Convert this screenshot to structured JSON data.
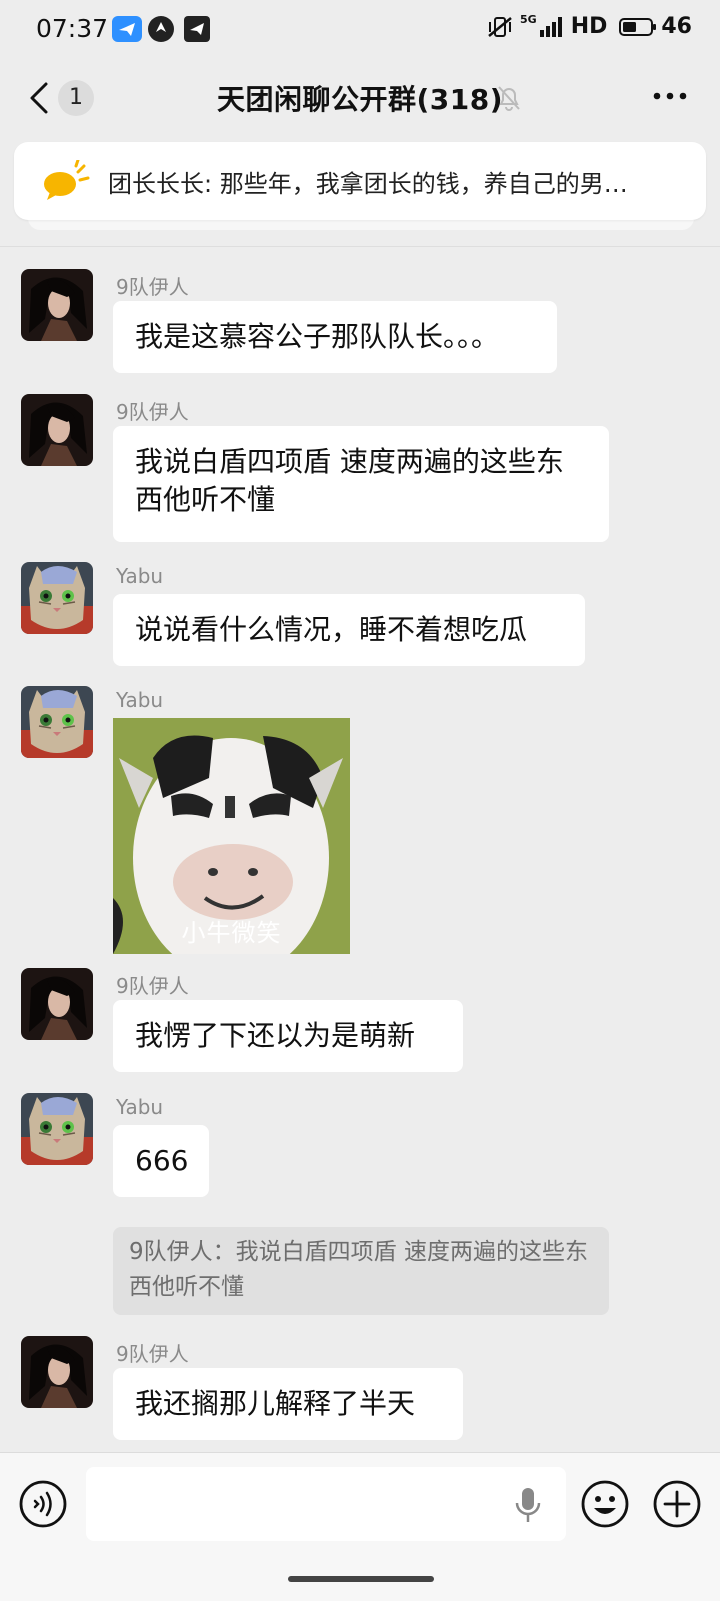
{
  "status_bar": {
    "time": "07:37",
    "network": "5G",
    "hd": "HD",
    "battery": "46",
    "app_icons": [
      "telegram-icon",
      "vpn-icon",
      "telegram-alt-icon"
    ]
  },
  "header": {
    "unread_count": "1",
    "title": "天团闲聊公开群(318)"
  },
  "notice": {
    "text": "团长长长: 那些年，我拿团长的钱，养自己的男…"
  },
  "messages": [
    {
      "sender": "9队伊人",
      "avatar": "dark-hair-avatar",
      "text": "我是这慕容公子那队队长。。。"
    },
    {
      "sender": "9队伊人",
      "avatar": "dark-hair-avatar",
      "text": "我说白盾四项盾 速度两遍的这些东西他听不懂"
    },
    {
      "sender": "Yabu",
      "avatar": "cat-avatar",
      "text": "说说看什么情况，睡不着想吃瓜"
    },
    {
      "sender": "Yabu",
      "avatar": "cat-avatar",
      "sticker_caption": "小牛微笑"
    },
    {
      "sender": "9队伊人",
      "avatar": "dark-hair-avatar",
      "text": "我愣了下还以为是萌新"
    },
    {
      "sender": "Yabu",
      "avatar": "cat-avatar",
      "text": "666",
      "quote": "9队伊人：我说白盾四项盾 速度两遍的这些东西他听不懂"
    },
    {
      "sender": "9队伊人",
      "avatar": "dark-hair-avatar",
      "text": "我还搁那儿解释了半天"
    }
  ],
  "input": {
    "placeholder": ""
  },
  "colors": {
    "background": "#ededed",
    "bubble": "#ffffff",
    "notice_icon": "#f7b500",
    "quote_bg": "#e0e0e0"
  }
}
